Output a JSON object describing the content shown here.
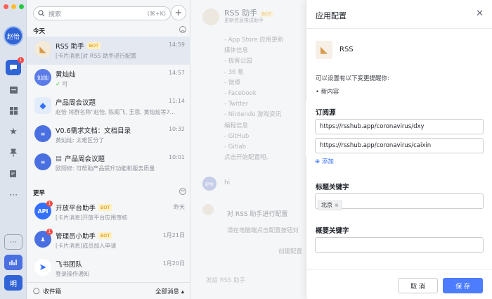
{
  "window": {
    "controls": [
      "#ff5f57",
      "#febc2e",
      "#28c840"
    ]
  },
  "rail": {
    "avatar": "赵怡",
    "bottom_app": "明"
  },
  "search": {
    "placeholder": "搜索",
    "shortcut": "(⌘+K)"
  },
  "sections": {
    "today": "今天",
    "earlier": "更早"
  },
  "chats": [
    {
      "name": "RSS 助手",
      "tag": "BOT",
      "time": "14:59",
      "preview": "[卡片消息]对 RSS 助手进行配置",
      "avatar_color": "#f3ead9"
    },
    {
      "name": "黄灿灿",
      "tag": "",
      "time": "14:57",
      "preview": "可",
      "avatar": "灿灿",
      "avatar_color": "#5b7be8"
    },
    {
      "name": "产品周会议题",
      "tag": "",
      "time": "11:14",
      "preview": "赵怡 将群名称\"赵怡, 陈阁飞, 王恩, 黄灿灿等7...",
      "avatar_color": "#e3ecfb"
    },
    {
      "name": "V0.6需求文档：文档目录",
      "tag": "",
      "time": "10:32",
      "preview": "黄灿灿: 太难区分了",
      "avatar_color": "#4a6fe0"
    },
    {
      "name": "产品周会议题",
      "tag": "",
      "time": "10:01",
      "preview": "欧阳修: 可帮助产品提升功能和服务质量",
      "avatar_color": "#4a6fe0"
    },
    {
      "name": "开放平台助手",
      "tag": "BOT",
      "time": "昨天",
      "preview": "[卡片消息]开放平台应用审核",
      "avatar": "API",
      "avatar_color": "#3370ff",
      "badge": "1"
    },
    {
      "name": "管理员小助手",
      "tag": "BOT",
      "time": "1月21日",
      "preview": "[卡片消息]成员加入申请",
      "avatar_color": "#4a6fe0",
      "badge": "1"
    },
    {
      "name": "飞书团队",
      "tag": "",
      "time": "1月20日",
      "preview": "登录操作通知",
      "avatar_color": "#ffffff"
    }
  ],
  "list_footer": {
    "left": "收件箱",
    "right": "全部消息 ▴"
  },
  "chat_pane": {
    "title": "RSS 助手",
    "title_tag": "BOT",
    "subtitle": "更新信息推送助手",
    "lines": [
      "- App Store 应用更新",
      "媒体信息",
      "- 极客公园",
      "- 36 氪",
      "- 微博",
      "- Facebook",
      "- Twitter",
      "- Nintendo 游戏资讯",
      "编程信息",
      "- GitHub",
      "- Gitlab",
      "点击开始配置吧。"
    ],
    "user_msg": "hi",
    "user_avatar": "赵怡",
    "card_title": "对 RSS 助手进行配置",
    "card_body": "请在电脑端点击配置按钮对",
    "card_button": "创建配置",
    "composer": "发给 RSS 助手"
  },
  "panel": {
    "title": "应用配置",
    "app_name": "RSS",
    "hint": "可以设置有以下变更提醒你:",
    "bullet": "• 新内容",
    "sub_label": "订阅源",
    "sources": [
      "https://rsshub.app/coronavirus/dxy",
      "https://rsshub.app/coronavirus/caixin"
    ],
    "add": "添加",
    "title_kw_label": "标题关键字",
    "title_keywords": [
      "北京"
    ],
    "summary_kw_label": "概要关键字",
    "summary_keywords": [],
    "cancel": "取 消",
    "save": "保 存"
  }
}
